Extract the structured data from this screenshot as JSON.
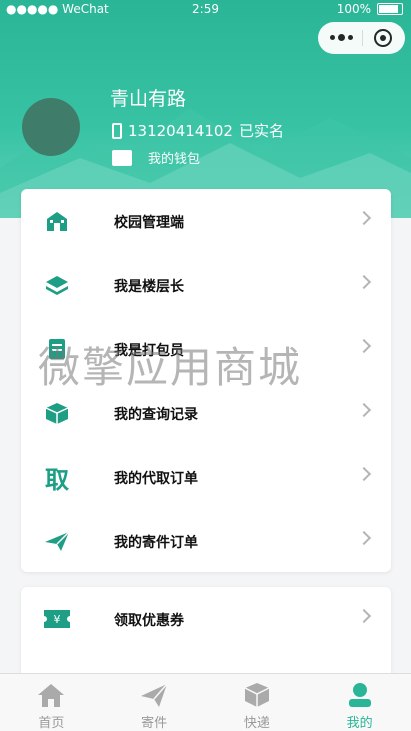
{
  "status_bar": {
    "carrier": "●●●●● WeChat",
    "time": "2:59",
    "battery": "100%"
  },
  "profile": {
    "name": "青山有路",
    "phone": "13120414102",
    "verified": "已实名",
    "wallet": "我的钱包"
  },
  "menu_main": [
    {
      "label": "校园管理端",
      "icon": "campus-building-icon"
    },
    {
      "label": "我是楼层长",
      "icon": "layers-icon"
    },
    {
      "label": "我是打包员",
      "icon": "package-person-icon"
    },
    {
      "label": "我的查询记录",
      "icon": "box-icon"
    },
    {
      "label": "我的代取订单",
      "icon": "pickup-char-icon"
    },
    {
      "label": "我的寄件订单",
      "icon": "paper-plane-icon"
    }
  ],
  "menu_secondary": [
    {
      "label": "领取优惠券",
      "icon": "coupon-icon"
    }
  ],
  "pickup_char": "取",
  "coupon_char": "¥",
  "watermark": "微擎应用商城",
  "tabs": [
    {
      "label": "首页",
      "icon": "home-icon",
      "active": false
    },
    {
      "label": "寄件",
      "icon": "send-icon",
      "active": false
    },
    {
      "label": "快递",
      "icon": "box-icon",
      "active": false
    },
    {
      "label": "我的",
      "icon": "user-icon",
      "active": true
    }
  ],
  "colors": {
    "primary": "#2bb597",
    "inactive": "#999999"
  }
}
